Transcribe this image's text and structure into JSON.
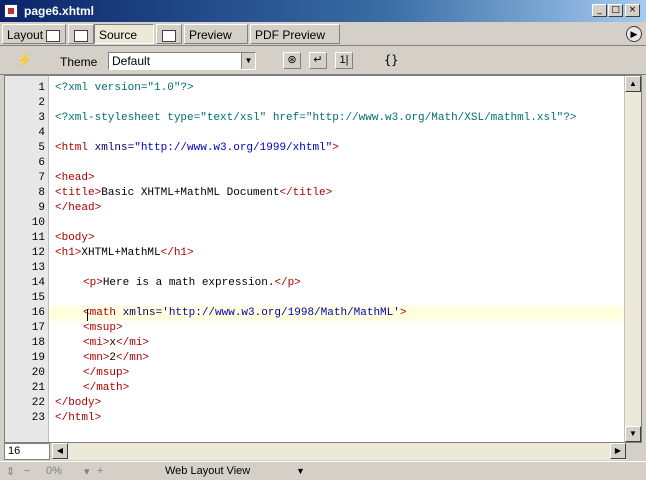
{
  "window": {
    "title": "page6.xhtml"
  },
  "tabs": [
    {
      "label": "Layout",
      "icon": "layout-icon"
    },
    {
      "label": "",
      "icon": "split-icon"
    },
    {
      "label": "Source",
      "icon": "source-icon",
      "active": true
    },
    {
      "label": "",
      "icon": "source-split-icon"
    },
    {
      "label": "Preview",
      "icon": "preview-icon"
    },
    {
      "label": "PDF Preview",
      "icon": "pdf-preview-icon"
    }
  ],
  "toolbar": {
    "theme_label": "Theme",
    "theme_value": "Default",
    "brace_label": "{}"
  },
  "editor": {
    "current_line": "16",
    "lines": [
      {
        "n": "1",
        "indent": "",
        "parts": [
          [
            "pi",
            "<?xml version=\"1.0\"?>"
          ]
        ]
      },
      {
        "n": "2",
        "indent": "",
        "parts": []
      },
      {
        "n": "3",
        "indent": "",
        "parts": [
          [
            "pi",
            "<?xml-stylesheet type=\"text/xsl\" href=\"http://www.w3.org/Math/XSL/mathml.xsl\"?>"
          ]
        ]
      },
      {
        "n": "4",
        "indent": "",
        "parts": []
      },
      {
        "n": "5",
        "indent": "",
        "parts": [
          [
            "tag",
            "<html "
          ],
          [
            "an",
            "xmlns="
          ],
          [
            "av",
            "\"http://www.w3.org/1999/xhtml\""
          ],
          [
            "tag",
            ">"
          ]
        ]
      },
      {
        "n": "6",
        "indent": "",
        "parts": []
      },
      {
        "n": "7",
        "indent": "",
        "parts": [
          [
            "tag",
            "<head>"
          ]
        ]
      },
      {
        "n": "8",
        "indent": "",
        "parts": [
          [
            "tag",
            "<title>"
          ],
          [
            "txt",
            "Basic XHTML+MathML Document"
          ],
          [
            "tag",
            "</title>"
          ]
        ]
      },
      {
        "n": "9",
        "indent": "",
        "parts": [
          [
            "tag",
            "</head>"
          ]
        ]
      },
      {
        "n": "10",
        "indent": "",
        "parts": []
      },
      {
        "n": "11",
        "indent": "",
        "parts": [
          [
            "tag",
            "<body>"
          ]
        ]
      },
      {
        "n": "12",
        "indent": "",
        "parts": [
          [
            "tag",
            "<h1>"
          ],
          [
            "txt",
            "XHTML+MathML"
          ],
          [
            "tag",
            "</h1>"
          ]
        ]
      },
      {
        "n": "13",
        "indent": "",
        "parts": []
      },
      {
        "n": "14",
        "indent": "    ",
        "parts": [
          [
            "tag",
            "<p>"
          ],
          [
            "txt",
            "Here is a math expression."
          ],
          [
            "tag",
            "</p>"
          ]
        ]
      },
      {
        "n": "15",
        "indent": "",
        "parts": []
      },
      {
        "n": "16",
        "indent": "    ",
        "parts": [
          [
            "tag",
            "<math "
          ],
          [
            "an",
            "xmlns="
          ],
          [
            "av",
            "'http://www.w3.org/1998/Math/MathML'"
          ],
          [
            "tag",
            ">"
          ]
        ]
      },
      {
        "n": "17",
        "indent": "    ",
        "parts": [
          [
            "tag",
            "<msup>"
          ]
        ]
      },
      {
        "n": "18",
        "indent": "    ",
        "parts": [
          [
            "tag",
            "<mi>"
          ],
          [
            "txt",
            "x"
          ],
          [
            "tag",
            "</mi>"
          ]
        ]
      },
      {
        "n": "19",
        "indent": "    ",
        "parts": [
          [
            "tag",
            "<mn>"
          ],
          [
            "txt",
            "2"
          ],
          [
            "tag",
            "</mn>"
          ]
        ]
      },
      {
        "n": "20",
        "indent": "    ",
        "parts": [
          [
            "tag",
            "</msup>"
          ]
        ]
      },
      {
        "n": "21",
        "indent": "    ",
        "parts": [
          [
            "tag",
            "</math>"
          ]
        ]
      },
      {
        "n": "22",
        "indent": "",
        "parts": [
          [
            "tag",
            "</body>"
          ]
        ]
      },
      {
        "n": "23",
        "indent": "",
        "parts": [
          [
            "tag",
            "</html>"
          ]
        ]
      }
    ]
  },
  "status": {
    "zoom": "0%",
    "view_mode": "Web Layout View"
  }
}
